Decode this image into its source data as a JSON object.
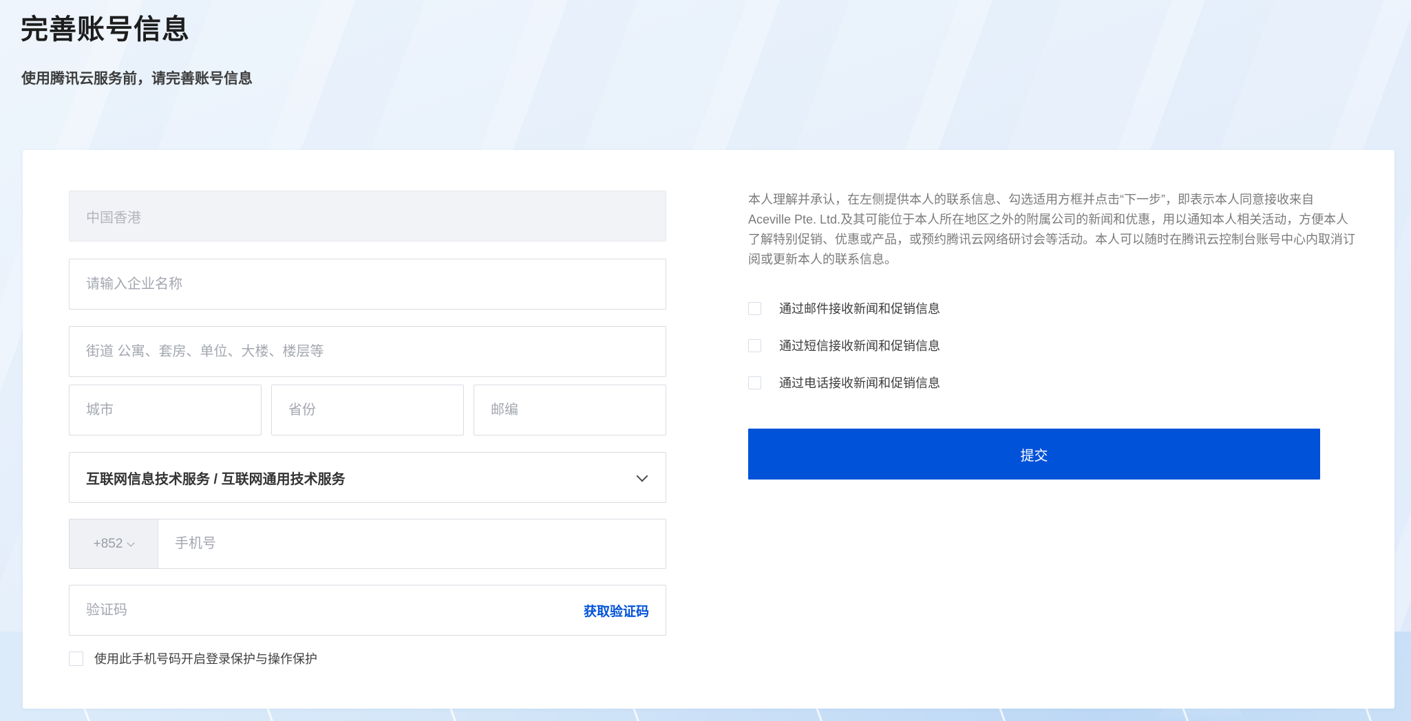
{
  "page": {
    "title": "完善账号信息",
    "subtitle": "使用腾讯云服务前，请完善账号信息"
  },
  "form": {
    "country": {
      "value": "中国香港"
    },
    "company": {
      "placeholder": "请输入企业名称"
    },
    "street": {
      "placeholder": "街道 公寓、套房、单位、大楼、楼层等"
    },
    "city": {
      "placeholder": "城市"
    },
    "province": {
      "placeholder": "省份"
    },
    "postcode": {
      "placeholder": "邮编"
    },
    "industry": {
      "value": "互联网信息技术服务 / 互联网通用技术服务"
    },
    "phone": {
      "country_code": "+852",
      "placeholder": "手机号"
    },
    "captcha": {
      "placeholder": "验证码",
      "action_label": "获取验证码"
    },
    "protection_label": "使用此手机号码开启登录保护与操作保护"
  },
  "consent": {
    "paragraph": "本人理解并承认，在左侧提供本人的联系信息、勾选适用方框并点击“下一步”，即表示本人同意接收来自 Aceville Pte. Ltd.及其可能位于本人所在地区之外的附属公司的新闻和优惠，用以通知本人相关活动，方便本人了解特别促销、优惠或产品，或预约腾讯云网络研讨会等活动。本人可以随时在腾讯云控制台账号中心内取消订阅或更新本人的联系信息。",
    "options": [
      {
        "label": "通过邮件接收新闻和促销信息"
      },
      {
        "label": "通过短信接收新闻和促销信息"
      },
      {
        "label": "通过电话接收新闻和促销信息"
      }
    ],
    "submit_label": "提交"
  },
  "icons": {
    "industry_dropdown": "chevron-down",
    "country_code_dropdown": "chevron-down"
  },
  "colors": {
    "accent": "#0052d9",
    "page_background": "#e7f0fb",
    "card_background": "#ffffff",
    "field_border": "#dadce2",
    "disabled_field_background": "#f2f3f6",
    "placeholder_text": "#a3a7af",
    "body_text": "#333333",
    "muted_text": "#7b7b7b"
  }
}
